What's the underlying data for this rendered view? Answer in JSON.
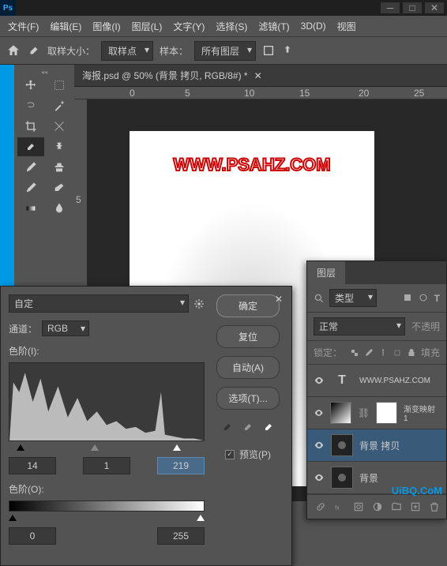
{
  "titlebar": {
    "ps": "Ps"
  },
  "menu": {
    "file": "文件(F)",
    "edit": "编辑(E)",
    "image": "图像(I)",
    "layer": "图层(L)",
    "type": "文字(Y)",
    "select": "选择(S)",
    "filter": "滤镜(T)",
    "threeD": "3D(D)",
    "view": "视图"
  },
  "options": {
    "sample_size_label": "取样大小：",
    "sample_size_value": "取样点",
    "sample_label": "样本：",
    "sample_value": "所有图层"
  },
  "doc": {
    "tab_title": "海报.psd @ 50% (背景 拷贝, RGB/8#) *",
    "watermark": "WWW.PSAHZ.COM"
  },
  "ruler": {
    "h": [
      "0",
      "5",
      "10",
      "15",
      "20",
      "25"
    ],
    "v": [
      "5"
    ]
  },
  "levels": {
    "preset_value": "自定",
    "channel_label": "通道：",
    "channel_value": "RGB",
    "input_label": "色阶(I):",
    "input_black": "14",
    "input_mid": "1",
    "input_white": "219",
    "output_label": "色阶(O):",
    "output_black": "0",
    "output_white": "255",
    "btn_ok": "确定",
    "btn_reset": "复位",
    "btn_auto": "自动(A)",
    "btn_options": "选项(T)...",
    "preview_label": "预览(P)"
  },
  "layers": {
    "tab": "图层",
    "filter_value": "类型",
    "blend_value": "正常",
    "opacity_label": "不透明",
    "lock_label": "锁定：",
    "fill_label": "填充",
    "items": [
      {
        "name": "WWW.PSAHZ.COM",
        "type": "T"
      },
      {
        "name": "渐变映射 1"
      },
      {
        "name": "背景 拷贝"
      },
      {
        "name": "背景"
      }
    ]
  },
  "footer_mark": "UiBQ.CoM",
  "chart_data": {
    "type": "histogram",
    "title": "色阶",
    "channel": "RGB",
    "input_range": [
      0,
      255
    ],
    "input_black": 14,
    "input_mid": 1.0,
    "input_white": 219,
    "output_range": [
      0,
      255
    ],
    "output_black": 0,
    "output_white": 255,
    "note": "Histogram shape shows pixel-luminance distribution skewed toward shadows with a long tail to highlights; exact per-bin counts not readable from screenshot."
  }
}
